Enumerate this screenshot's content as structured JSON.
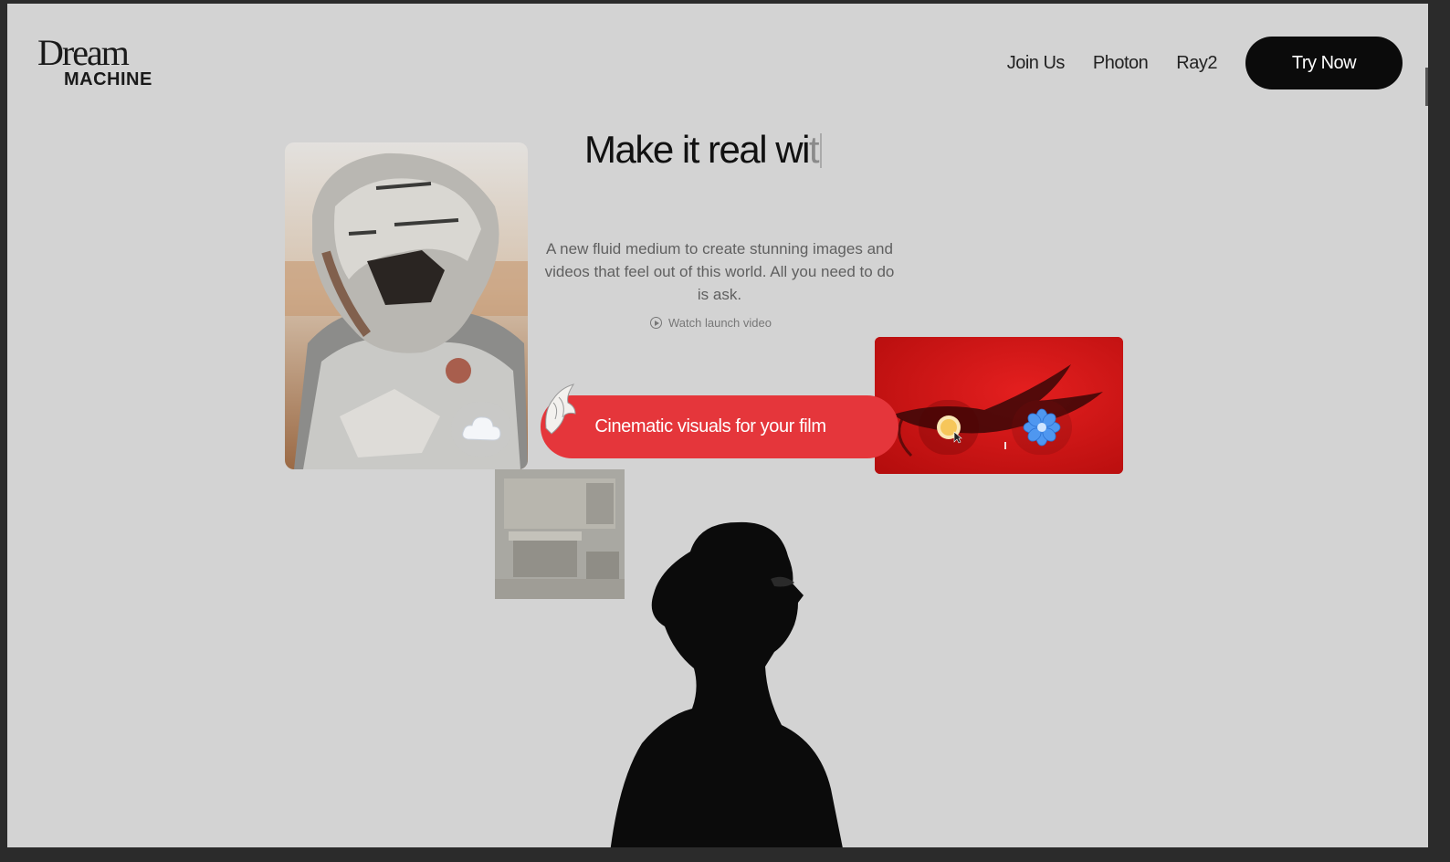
{
  "brand": {
    "line1": "Dream",
    "line2": "MACHINE"
  },
  "nav": {
    "links": [
      {
        "label": "Join Us"
      },
      {
        "label": "Photon"
      },
      {
        "label": "Ray2"
      }
    ],
    "cta": "Try Now"
  },
  "hero": {
    "headline": "Make it real wi",
    "headline_fading": "t",
    "description": "A new fluid medium to create stunning images and videos that feel out of this world. All you need to do is ask.",
    "watch_link": "Watch launch video",
    "pill": "Cinematic visuals for your film"
  },
  "icons": [
    "play-circle-icon",
    "bird-icon",
    "cloud-icon",
    "sun-icon",
    "flower-icon",
    "cursor-icon"
  ],
  "colors": {
    "page_bg": "#d3d3d3",
    "cta_bg": "#0b0b0b",
    "pill_bg": "#e5363b",
    "red_card": "#d51414",
    "frame": "#2b2b2b"
  }
}
